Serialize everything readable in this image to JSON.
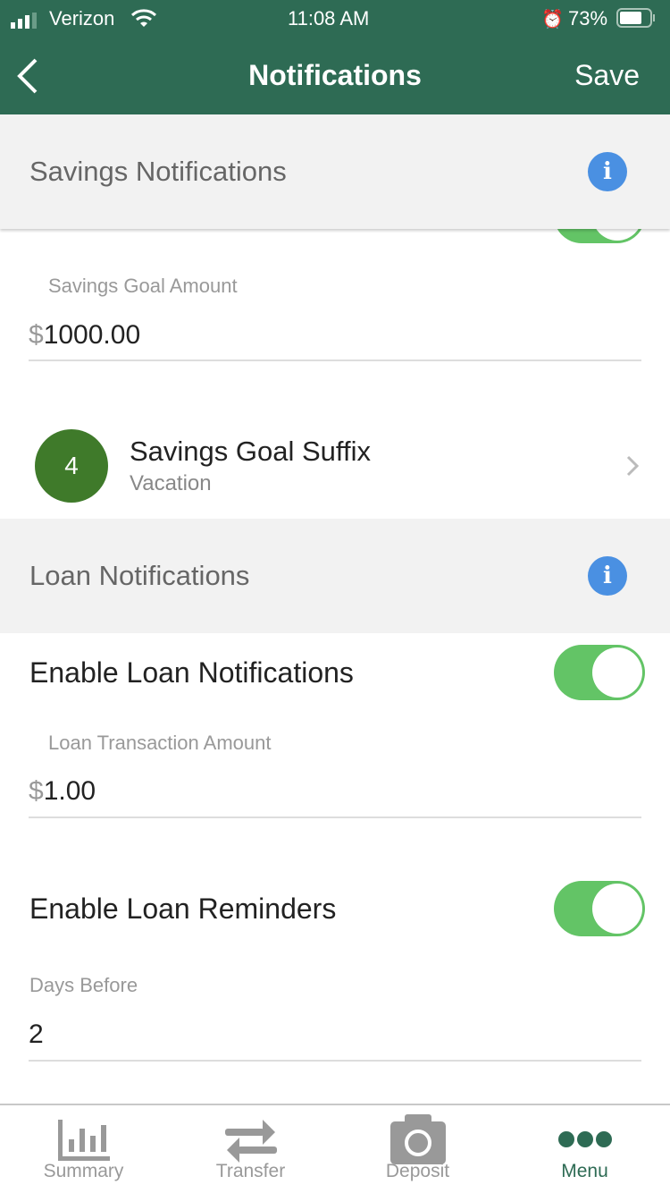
{
  "status": {
    "carrier": "Verizon",
    "time": "11:08 AM",
    "battery": "73%"
  },
  "nav": {
    "title": "Notifications",
    "save": "Save"
  },
  "savings": {
    "header": "Savings Notifications",
    "goal_label": "Savings Goal Amount",
    "currency": "$",
    "goal_value": "1000.00",
    "suffix_badge": "4",
    "suffix_title": "Savings Goal Suffix",
    "suffix_value": "Vacation"
  },
  "loan": {
    "header": "Loan Notifications",
    "enable_label": "Enable Loan Notifications",
    "amount_label": "Loan Transaction Amount",
    "currency": "$",
    "amount_value": "1.00",
    "reminders_label": "Enable Loan Reminders",
    "days_label": "Days Before",
    "days_value": "2"
  },
  "tabs": [
    {
      "label": "Summary"
    },
    {
      "label": "Transfer"
    },
    {
      "label": "Deposit"
    },
    {
      "label": "Menu"
    }
  ],
  "colors": {
    "brand": "#2e6b54",
    "toggle_on": "#63c466",
    "info": "#4a90e2",
    "badge": "#3f7a2a"
  }
}
